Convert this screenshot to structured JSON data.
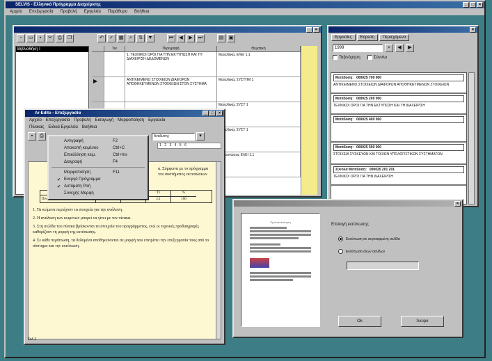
{
  "outer_window": {
    "title": "SELVIS - Ελληνικό Πρόγραμμα Διαχείρισης"
  },
  "main_menu": [
    "Αρχείο",
    "Επεξεργασία",
    "Προβολή",
    "Εργαλεία",
    "Παράθυρο",
    "Βοήθεια"
  ],
  "grid_window": {
    "sidebar_item": "Βιβλιοθήκη Ι",
    "columns": [
      "Τεκ",
      "Περιγραφή",
      "Θεματική"
    ],
    "rows": [
      {
        "arrow": "",
        "desc": "1. ΤΕΧΝΙΚΟΙ ΟΡΟΙ ΓΙΑ ΤΗΝ ΕΚΤΥΠΩΣΗ ΚΑΙ ΤΗ ΔΙΑΧΕΙΡΙΣΗ ΔΕΔΟΜΕΝΩΝ",
        "theme": "Μεταλλικές ΕΛΕΙ 1.1"
      },
      {
        "arrow": "▶",
        "desc": "ΑΝΤΙΚΕΙΜΕΝΟ ΣΤΟΙΧΕΙΩΝ ΔΙΑΦΟΡΩΝ ΑΠΟΘΗΚΕΥΜΕΝΩΝ ΣΤΟΙΧΕΙΩΝ ΣΤΟΝ ΣΥΣΤΗΜΑ",
        "theme": "Μεταλλικές ΣΥΣΤΗΜ 1"
      },
      {
        "arrow": "",
        "desc": "",
        "theme": "Μεταλλικές ΣΥΣΤ 1"
      },
      {
        "arrow": "",
        "desc": "",
        "theme": "Μεταλλικές ΣΥΣΤ 1"
      },
      {
        "arrow": "",
        "desc": "",
        "theme": "Ανακοινώσεις ΕΛΕΙ 1.1"
      }
    ]
  },
  "right_panel": {
    "tabs": [
      "Εργασίες",
      "Εύρεση",
      "Περιεχόμενα"
    ],
    "search_value": "1999",
    "check1": "Ταξινόμηση",
    "check2": "Σύνολο",
    "records": [
      {
        "label": "Μετάδοση:",
        "code": "000025 700 000",
        "text": "ΑΝΤΙΚΕΙΜΕΝΟ ΣΤΟΙΧΕΙΩΝ ΔΙΑΦΟΡΩΝ ΑΠΟΘΗΚΕΥΜΕΝΩΝ ΣΤΟΙΧΕΙΩΝ"
      },
      {
        "label": "Μετάδοση:",
        "code": "000025 200 000",
        "text": "ΤΕΧΝΙΚΟΙ ΟΡΟΙ ΓΙΑ ΤΗΝ ΕΚΤΥΠΩΣΗ ΚΑΙ ΤΗ ΔΙΑΧΕΙΡΙΣΗ"
      },
      {
        "label": "Μετάδοση:",
        "code": "000025 400 000",
        "text": ""
      },
      {
        "label": "Μετάδοση:",
        "code": "000025 500 000",
        "text": "ΣΤΟΙΧΕΙΑ ΣΥΣΚΕΥΩΝ ΚΑΙ ΤΟΙΧΩΝ ΥΠΟΛΟΓΙΣΤΙΚΩΝ ΣΥΣΤΗΜΑΤΩΝ"
      },
      {
        "label": "Σύνολα Μετάδοση:",
        "code": "000025 201 201",
        "text": "ΤΕΧΝΙΚΟΙ ΟΡΟΙ ΓΙΑ ΤΗΝ ΔΙΑΧΕΙΡΙΣΗ"
      }
    ]
  },
  "editor": {
    "title": "Ar-Edito - Επεξεργασία",
    "menu1": [
      "Αρχείο",
      "Επεξεργασία",
      "Προβολή",
      "Εισαγωγή",
      "Μορφοποίηση",
      "Εργαλεία"
    ],
    "menu2": [
      "Πίνακας",
      "Ειδικά Εργαλεία",
      "Βοήθεια"
    ],
    "font_box": "Ανάλυσης",
    "ruler": "1 · 2 · 3 · 4 · 5 · 6",
    "paragraphs": [
      "α. Σύμφωνα με το πρόγραμμα του συστήματος εκτυπώσεων",
      "1. Τα κείμενα περιέχουν τα στοιχεία για την ανάλυση.",
      "2. Η ανάλυση των κειμένων μπορεί να γίνει με τον πίνακα.",
      "3. Στη σελίδα του πίνακα βρίσκονται τα στοιχεία του προγράμματος, ενώ οι τεχνικές προδιαγραφές καθορίζουν τη μορφή της εκτύπωσης.",
      "4. Σε κάθε περίπτωση, τα δεδομένα αποθηκεύονται σε μορφή που επιτρέπει την επεξεργασία τους από το σύστημα και την εκτύπωση."
    ],
    "table": {
      "head": [
        "",
        "",
        "Σύνολο",
        "Τ1",
        "%"
      ],
      "row": [
        "Πίνακας στοιχ. (2000)",
        "1,2",
        "1,3",
        "2,1",
        "100"
      ]
    },
    "status": "Σελ 1"
  },
  "context_menu": [
    {
      "label": "Αντιγραφή",
      "key": "F2",
      "checked": false
    },
    {
      "label": "Αποκοπή κειμένου",
      "key": "Ctrl+C",
      "checked": false
    },
    {
      "label": "Επικόλληση κειμ.",
      "key": "Ctrl+Ins",
      "checked": false
    },
    {
      "label": "Διαγραφή",
      "key": "F4",
      "checked": false
    },
    {
      "label": "Μορφοποίηση",
      "key": "F11",
      "checked": false
    },
    {
      "label": "Ενεργό Πρόγραμμα",
      "key": "",
      "checked": true
    },
    {
      "label": "Αυτόματη Ροή",
      "key": "",
      "checked": true
    },
    {
      "label": "Συνεχής Μορφή",
      "key": "",
      "checked": false
    }
  ],
  "print_dialog": {
    "heading": "Επιλογή εκτύπωσης",
    "option1": "Εκτύπωση σε συγκεκριμένη σελίδα",
    "option2": "Εκτύπωση όλων σελίδων",
    "preview_title": "Προεπισκόπηση",
    "ok": "Ok",
    "cancel": "Άκυρο"
  }
}
